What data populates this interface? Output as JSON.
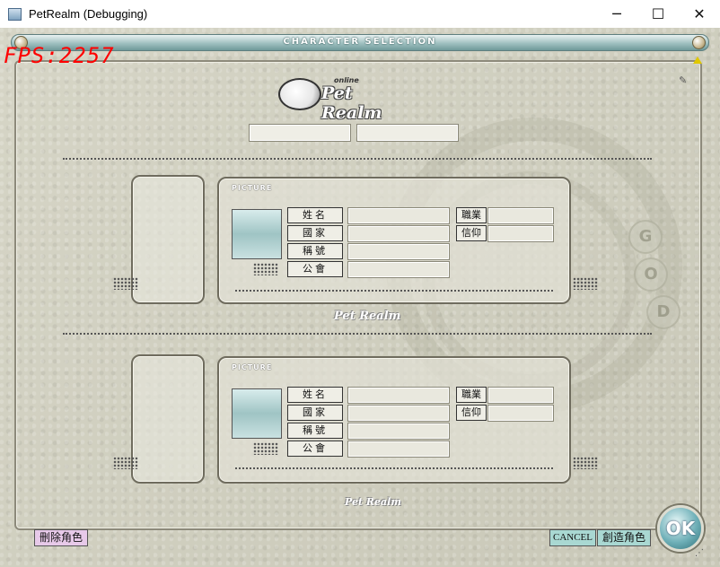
{
  "window": {
    "title": "PetRealm (Debugging)",
    "minimize_glyph": "─",
    "maximize_glyph": "☐",
    "close_glyph": "✕"
  },
  "game": {
    "header_title": "CHARACTER SELECTION",
    "fps": "FPS:2257",
    "logo_online": "online",
    "logo_text": "Pet Realm",
    "watermark": "Pet Realm",
    "god_letters": [
      "G",
      "O",
      "D"
    ],
    "slots": [
      {
        "picture_label": "PICTURE",
        "labels": {
          "name": "姓名",
          "nation": "國家",
          "title": "稱號",
          "guild": "公會",
          "job": "職業",
          "faith": "信仰"
        }
      },
      {
        "picture_label": "PICTURE",
        "labels": {
          "name": "姓名",
          "nation": "國家",
          "title": "稱號",
          "guild": "公會",
          "job": "職業",
          "faith": "信仰"
        }
      }
    ],
    "buttons": {
      "delete": "刪除角色",
      "cancel": "CANCEL",
      "create": "創造角色",
      "ok": "OK"
    },
    "colors": {
      "header_bar": "#9fc0c0",
      "fps_text": "#ff0000",
      "delete_button": "#e7c9e9",
      "cancel_button": "#a9d8d2",
      "create_button": "#a9d8d2",
      "ok_button": "#6fb0b8"
    }
  }
}
